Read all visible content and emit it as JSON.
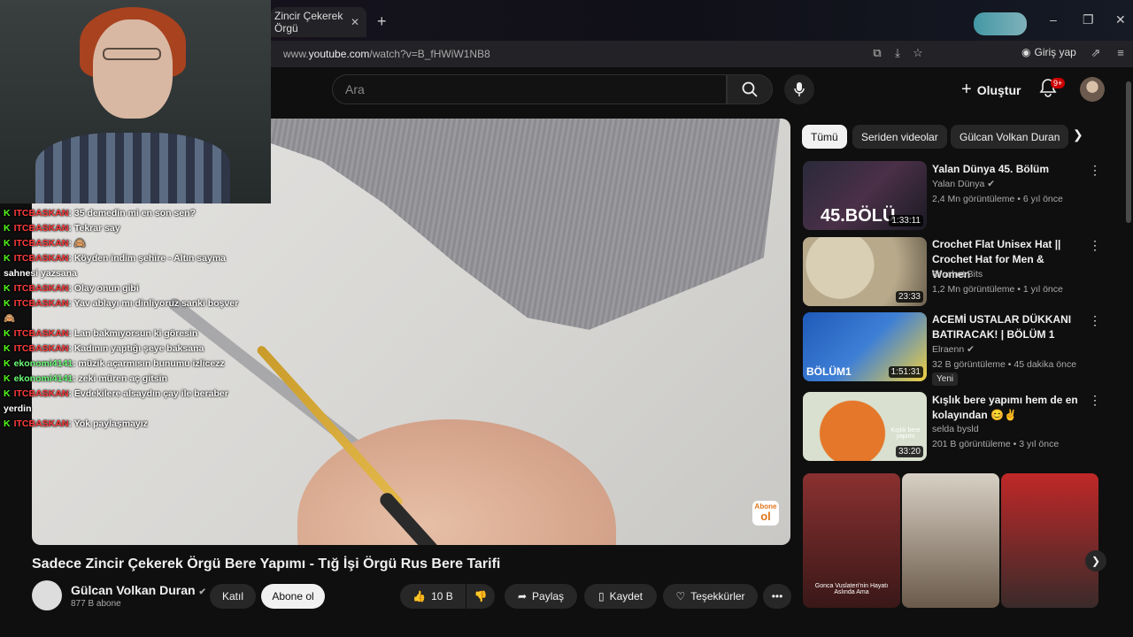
{
  "browser": {
    "tab_title": "Zincir Çekerek Örgü",
    "url_prefix": "www.",
    "url_domain": "youtube.com",
    "url_path": "/watch?v=B_fHWiW1NB8",
    "login_label": "Giriş yap"
  },
  "header": {
    "search_placeholder": "Ara",
    "create_label": "Oluştur",
    "notification_count": "9+"
  },
  "video": {
    "title": "Sadece Zincir Çekerek Örgü Bere Yapımı - Tığ İşi Örgü Rus Bere Tarifi",
    "watermark_line1": "Abone",
    "watermark_line2": "ol",
    "channel": {
      "name": "Gülcan Volkan Duran",
      "subscribers": "877 B abone"
    },
    "actions": {
      "join": "Katıl",
      "subscribe": "Abone ol",
      "likes": "10 B",
      "share": "Paylaş",
      "save": "Kaydet",
      "thanks": "Teşekkürler"
    }
  },
  "chat": [
    {
      "user": "ITCBASKAN",
      "color": "red",
      "text": ": 35 demedin mi en son sen?"
    },
    {
      "user": "ITCBASKAN",
      "color": "red",
      "text": ": Tekrar say"
    },
    {
      "user": "ITCBASKAN",
      "color": "red",
      "text": ": 🙈"
    },
    {
      "user": "ITCBASKAN",
      "color": "red",
      "text": ": Köyden indim şehire - Altın sayma sahnesi yazsana"
    },
    {
      "user": "ITCBASKAN",
      "color": "red",
      "text": ": Olay onun gibi"
    },
    {
      "user": "ITCBASKAN",
      "color": "red",
      "text": ": Yav ablayı mı dinliyoruz sanki boşver 🙈"
    },
    {
      "user": "ITCBASKAN",
      "color": "red",
      "text": ": Lan bakmıyorsun ki göresin"
    },
    {
      "user": "ITCBASKAN",
      "color": "red",
      "text": ": Kadının yaptığı şeye baksana"
    },
    {
      "user": "ekonomi4141",
      "color": "green",
      "text": ": müzik açarmısın bunumu izlicezz"
    },
    {
      "user": "ekonomi4141",
      "color": "green",
      "text": ": zeki müren aç gitsin"
    },
    {
      "user": "ITCBASKAN",
      "color": "red",
      "text": ": Evdekilere alsaydın çay ile beraber yerdin"
    },
    {
      "user": "ITCBASKAN",
      "color": "red",
      "text": ": Yok paylaşmayız"
    }
  ],
  "sidebar": {
    "chips": [
      "Tümü",
      "Seriden videolar",
      "Gülcan Volkan Duran"
    ],
    "videos": [
      {
        "title": "Yalan Dünya 45. Bölüm",
        "channel": "Yalan Dünya",
        "views": "2,4 Mn görüntüleme • 6 yıl önce",
        "duration": "1:33:11",
        "thumb_text": "45.BÖLÜ",
        "verified": true
      },
      {
        "title": "Crochet Flat Unisex Hat || Crochet Hat for Men & Women",
        "channel": "Crochet Bits",
        "views": "1,2 Mn görüntüleme • 1 yıl önce",
        "duration": "23:33",
        "verified": false
      },
      {
        "title": "ACEMİ USTALAR DÜKKANI BATIRACAK! | BÖLÜM 1",
        "channel": "Elraenn",
        "views": "32 B görüntüleme • 45 dakika önce",
        "duration": "1:51:31",
        "thumb_text": "BÖLÜM1",
        "badge": "Yeni",
        "verified": true
      },
      {
        "title": "Kışlık bere yapımı hem de en kolayından 😊✌",
        "channel": "selda bysld",
        "views": "201 B görüntüleme • 3 yıl önce",
        "duration": "33:20",
        "thumb_text": "Kışlık bere yapımı",
        "verified": false
      }
    ],
    "shorts_caption": "Gonca Vuslateri'nin Hayatı Aslında Ama"
  }
}
